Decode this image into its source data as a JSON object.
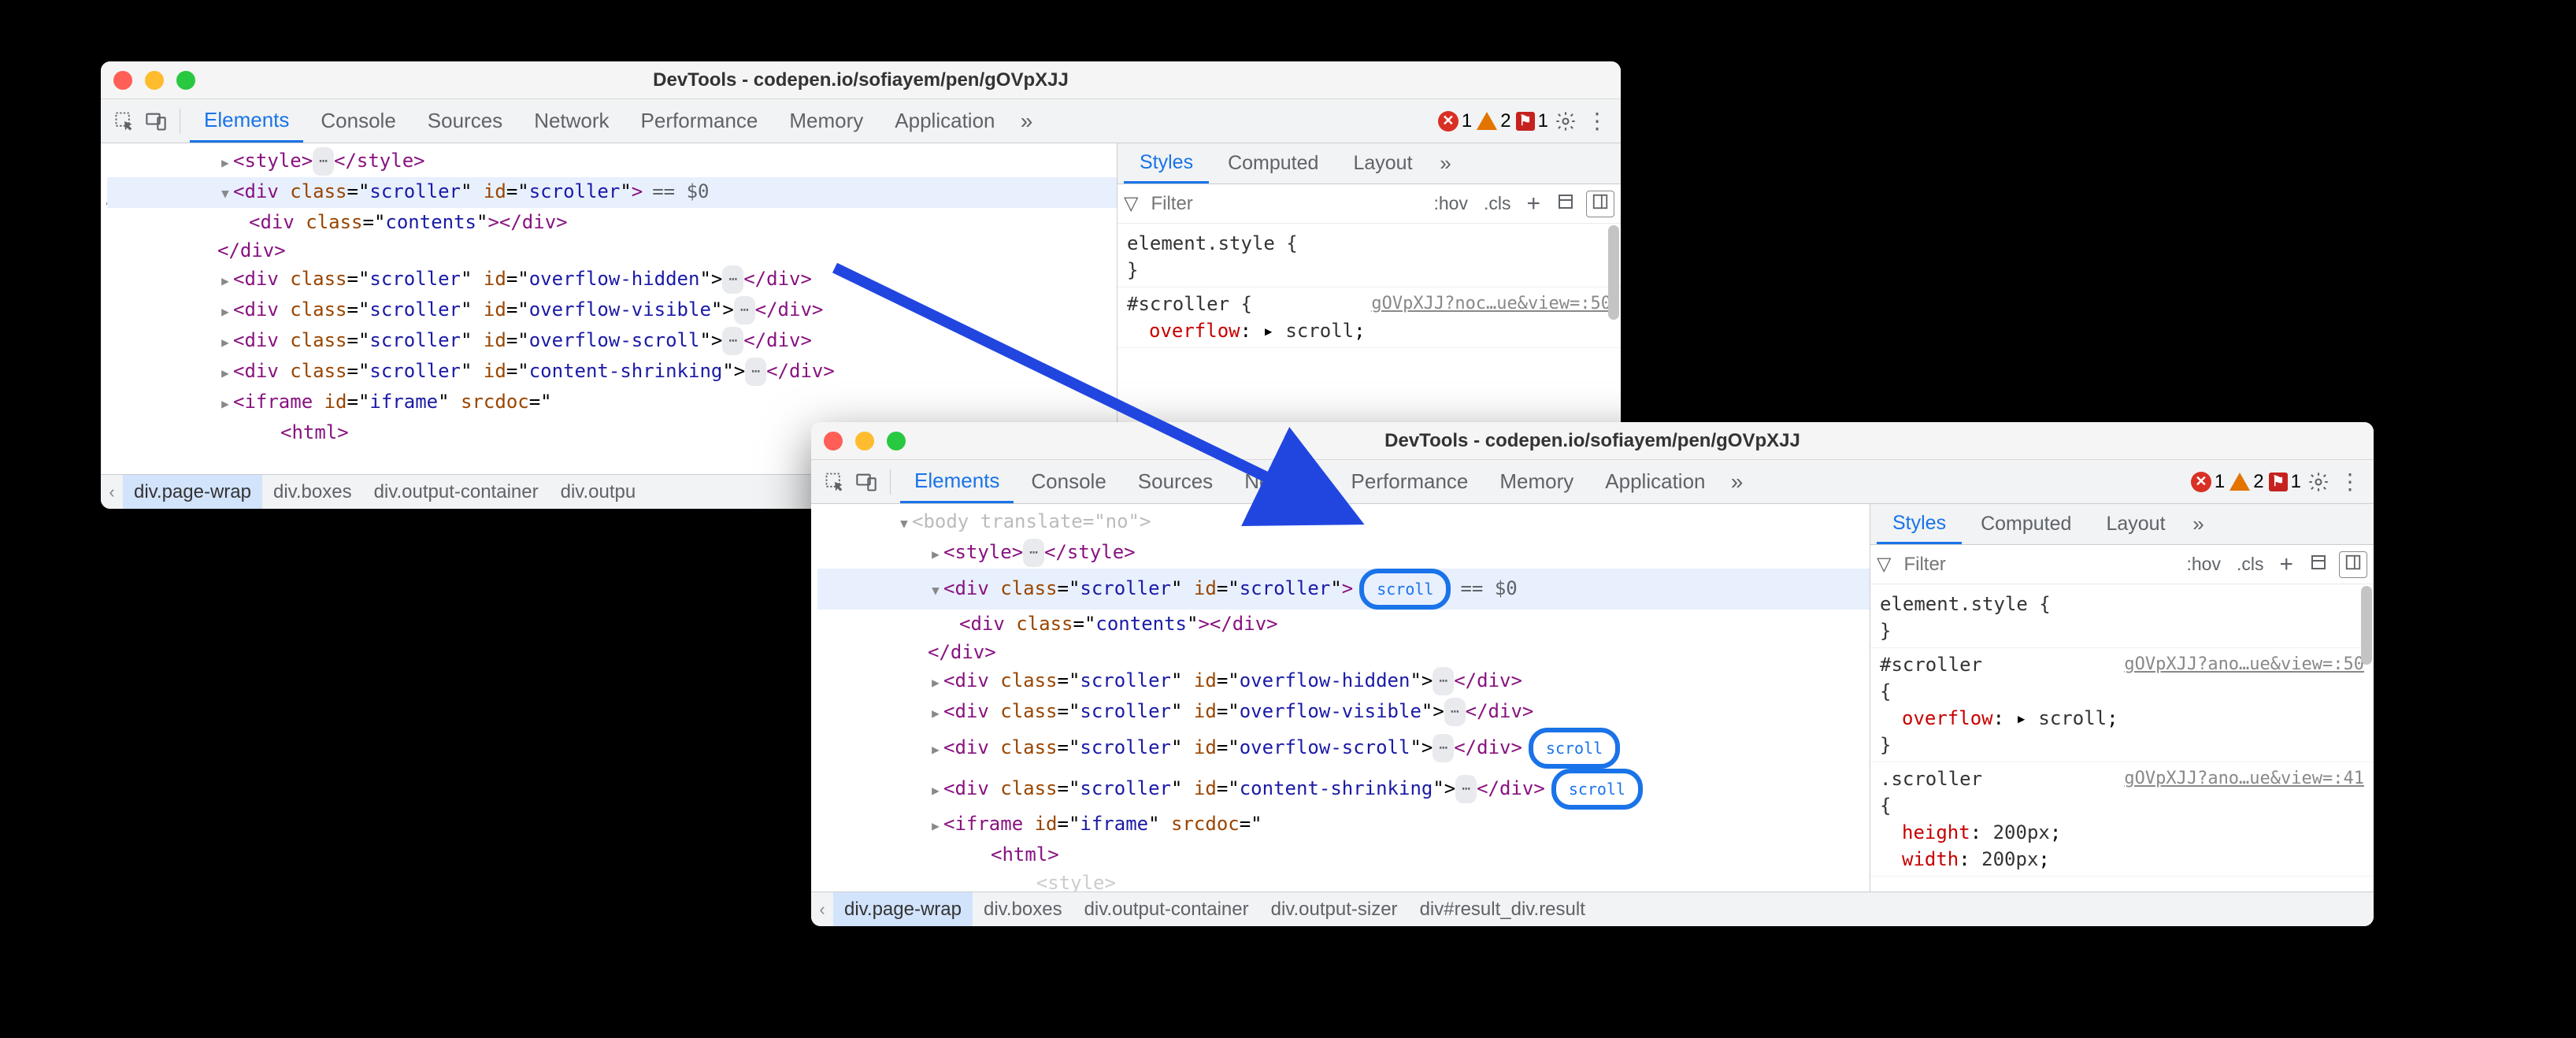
{
  "window1": {
    "title": "DevTools - codepen.io/sofiayem/pen/gOVpXJJ",
    "tabs": [
      "Elements",
      "Console",
      "Sources",
      "Network",
      "Performance",
      "Memory",
      "Application"
    ],
    "active_tab": "Elements",
    "status": {
      "errors": "1",
      "warnings": "2",
      "issues": "1"
    },
    "tree": {
      "r1_open": "<style>",
      "r1_close": "</style>",
      "r2_open": "<div ",
      "r2_attr1": "class",
      "r2_val1": "scroller",
      "r2_attr2": "id",
      "r2_val2": "scroller",
      "r2_close": ">",
      "r2_eq": "== $0",
      "r3_open": "<div ",
      "r3_attr1": "class",
      "r3_val1": "contents",
      "r3_close": "></div>",
      "r4": "</div>",
      "r5_open": "<div ",
      "r5_a1": "class",
      "r5_v1": "scroller",
      "r5_a2": "id",
      "r5_v2": "overflow-hidden",
      "r5_close": "</div>",
      "r6_open": "<div ",
      "r6_a1": "class",
      "r6_v1": "scroller",
      "r6_a2": "id",
      "r6_v2": "overflow-visible",
      "r6_close": "</div>",
      "r7_open": "<div ",
      "r7_a1": "class",
      "r7_v1": "scroller",
      "r7_a2": "id",
      "r7_v2": "overflow-scroll",
      "r7_close": "</div>",
      "r8_open": "<div ",
      "r8_a1": "class",
      "r8_v1": "scroller",
      "r8_a2": "id",
      "r8_v2": "content-shrinking",
      "r8_close": "</div>",
      "r9_open": "<iframe ",
      "r9_a1": "id",
      "r9_v1": "iframe",
      "r9_a2": "srcdoc",
      "r9_v2": "",
      "r10": "<html>"
    },
    "crumbs": [
      "div.page-wrap",
      "div.boxes",
      "div.output-container",
      "div.outpu"
    ],
    "styles": {
      "tabs": [
        "Styles",
        "Computed",
        "Layout"
      ],
      "active": "Styles",
      "filter_ph": "Filter",
      "hov": ":hov",
      "cls": ".cls",
      "r1": "element.style {",
      "r1b": "}",
      "r2": "#scroller {",
      "r2src": "gOVpXJJ?noc…ue&view=:50",
      "r2p": "overflow",
      "r2v": "scroll",
      "r2c": ": ▸ ",
      "r2end": ";"
    }
  },
  "window2": {
    "title": "DevTools - codepen.io/sofiayem/pen/gOVpXJJ",
    "tabs": [
      "Elements",
      "Console",
      "Sources",
      "Network",
      "Performance",
      "Memory",
      "Application"
    ],
    "active_tab": "Elements",
    "status": {
      "errors": "1",
      "warnings": "2",
      "issues": "1"
    },
    "tree": {
      "r0": "<body translate=\"no\">",
      "r1_open": "<style>",
      "r1_close": "</style>",
      "r2_open": "<div ",
      "r2_attr1": "class",
      "r2_val1": "scroller",
      "r2_attr2": "id",
      "r2_val2": "scroller",
      "r2_close": ">",
      "r2_badge": "scroll",
      "r2_eq": "== $0",
      "r3_open": "<div ",
      "r3_attr1": "class",
      "r3_val1": "contents",
      "r3_close": "></div>",
      "r4": "</div>",
      "r5_open": "<div ",
      "r5_a1": "class",
      "r5_v1": "scroller",
      "r5_a2": "id",
      "r5_v2": "overflow-hidden",
      "r5_close": "</div>",
      "r6_open": "<div ",
      "r6_a1": "class",
      "r6_v1": "scroller",
      "r6_a2": "id",
      "r6_v2": "overflow-visible",
      "r6_close": "</div>",
      "r7_open": "<div ",
      "r7_a1": "class",
      "r7_v1": "scroller",
      "r7_a2": "id",
      "r7_v2": "overflow-scroll",
      "r7_close": "</div>",
      "r7_badge": "scroll",
      "r8_open": "<div ",
      "r8_a1": "class",
      "r8_v1": "scroller",
      "r8_a2": "id",
      "r8_v2": "content-shrinking",
      "r8_close": "</div>",
      "r8_badge": "scroll",
      "r9_open": "<iframe ",
      "r9_a1": "id",
      "r9_v1": "iframe",
      "r9_a2": "srcdoc",
      "r9_v2": "",
      "r10": "<html>",
      "r11": "<style>"
    },
    "crumbs": [
      "div.page-wrap",
      "div.boxes",
      "div.output-container",
      "div.output-sizer",
      "div#result_div.result"
    ],
    "styles": {
      "tabs": [
        "Styles",
        "Computed",
        "Layout"
      ],
      "active": "Styles",
      "filter_ph": "Filter",
      "hov": ":hov",
      "cls": ".cls",
      "r1": "element.style {",
      "r1b": "}",
      "r2": "#scroller",
      "r2b": "{",
      "r2src": "gOVpXJJ?ano…ue&view=:50",
      "r2p": "overflow",
      "r2v": "scroll",
      "r2c": ": ▸ ",
      "r2end": ";",
      "r2close": "}",
      "r3": ".scroller",
      "r3b": "{",
      "r3src": "gOVpXJJ?ano…ue&view=:41",
      "r3p1": "height",
      "r3v1": "200px",
      "r3p2": "width",
      "r3v2": "200px"
    }
  }
}
